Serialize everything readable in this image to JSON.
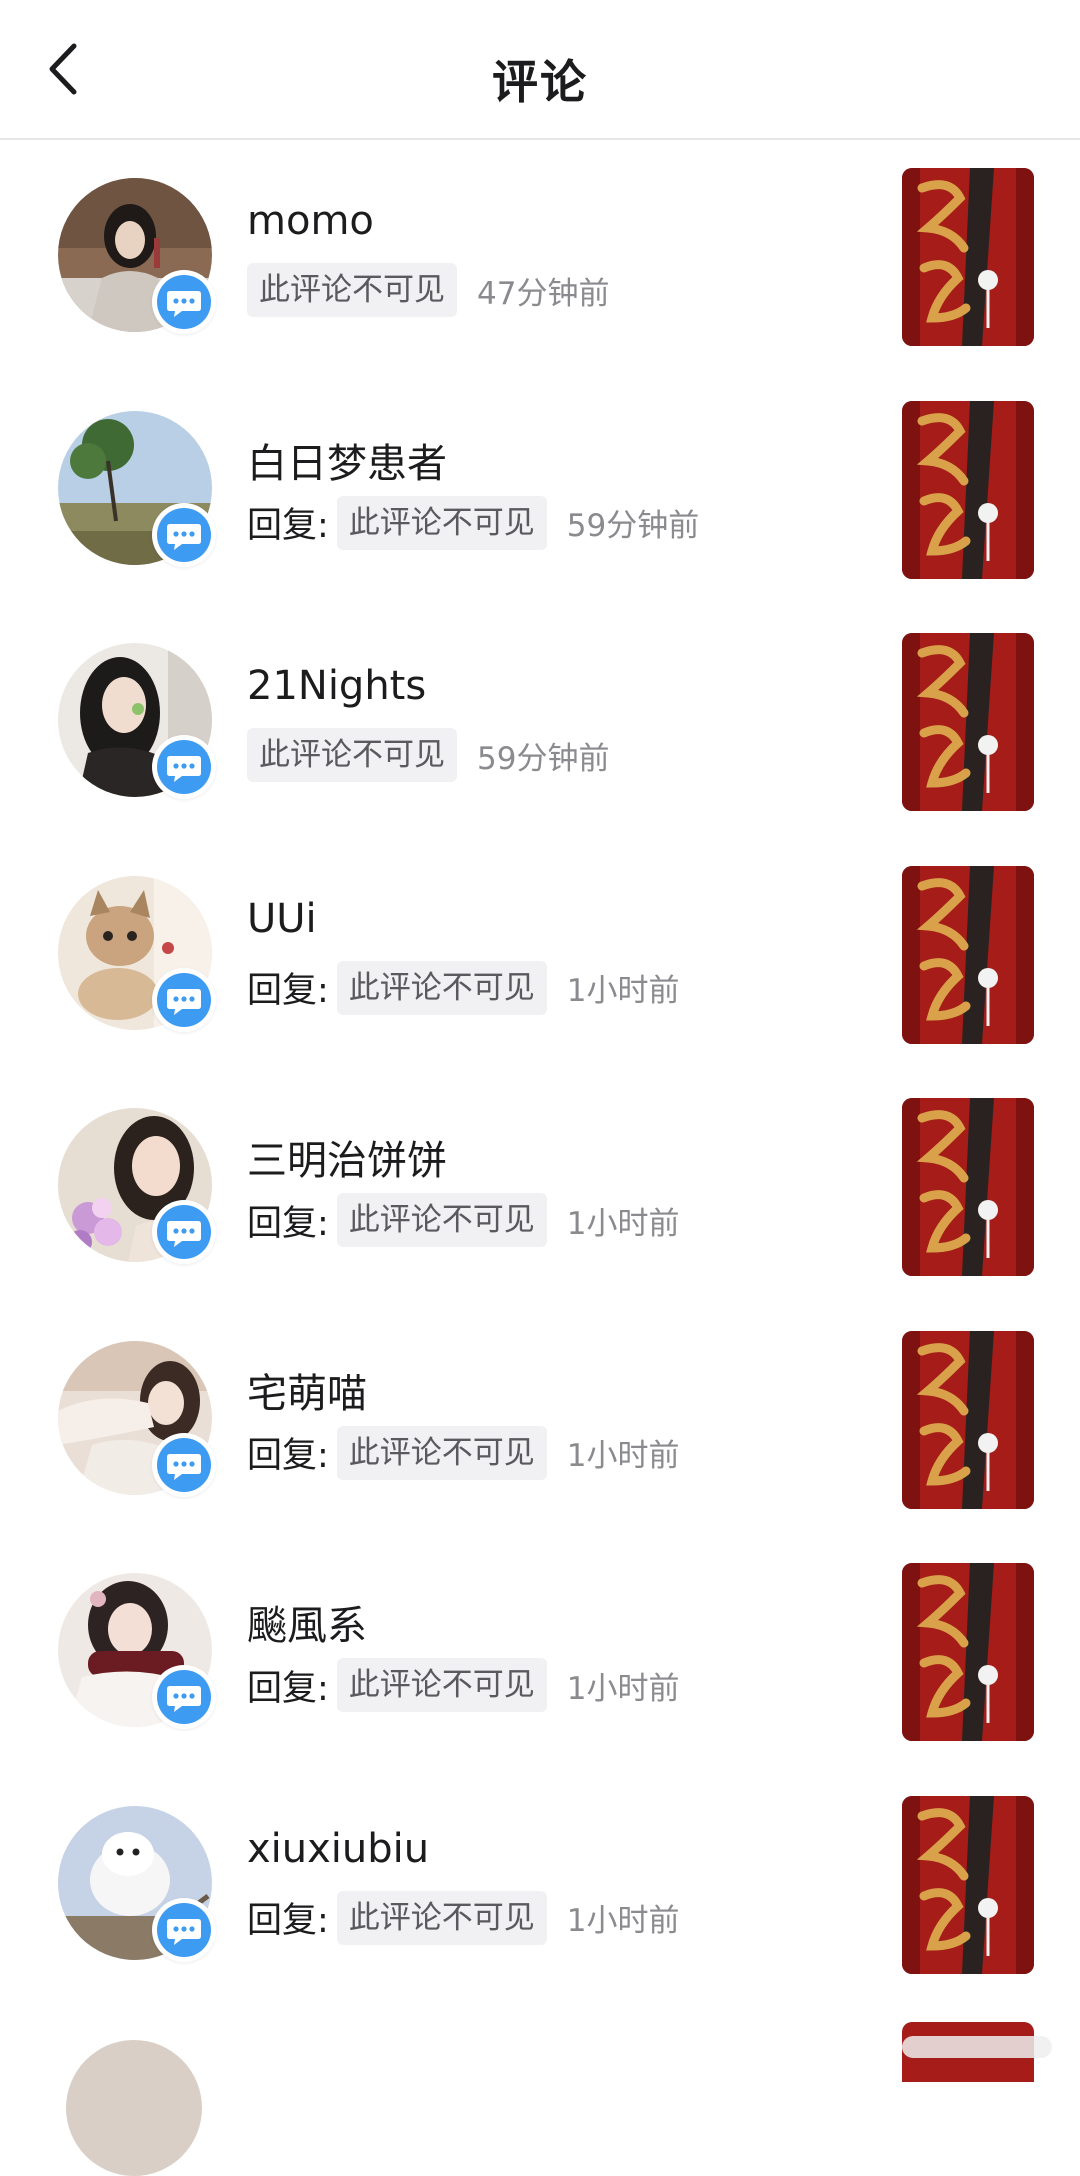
{
  "header": {
    "title": "评论",
    "back_icon": "chevron-left-icon"
  },
  "colors": {
    "badge_blue": "#3e9bf2",
    "chip_bg": "#f1f1f3",
    "time_gray": "#8a8a8f",
    "thumb_red": "#a51c18",
    "thumb_gold": "#d9a24a"
  },
  "comments": [
    {
      "name": "momo",
      "reply_label": "",
      "comment": "此评论不可见",
      "time": "47分钟前",
      "badge_icon": "comment-bubble-icon"
    },
    {
      "name": "白日梦患者",
      "reply_label": "回复:",
      "comment": "此评论不可见",
      "time": "59分钟前",
      "badge_icon": "comment-bubble-icon"
    },
    {
      "name": "21Nights",
      "reply_label": "",
      "comment": "此评论不可见",
      "time": "59分钟前",
      "badge_icon": "comment-bubble-icon"
    },
    {
      "name": "UUi",
      "reply_label": "回复:",
      "comment": "此评论不可见",
      "time": "1小时前",
      "badge_icon": "comment-bubble-icon"
    },
    {
      "name": "三明治饼饼",
      "reply_label": "回复:",
      "comment": "此评论不可见",
      "time": "1小时前",
      "badge_icon": "comment-bubble-icon"
    },
    {
      "name": "宅萌喵",
      "reply_label": "回复:",
      "comment": "此评论不可见",
      "time": "1小时前",
      "badge_icon": "comment-bubble-icon"
    },
    {
      "name": "飈風系",
      "reply_label": "回复:",
      "comment": "此评论不可见",
      "time": "1小时前",
      "badge_icon": "comment-bubble-icon"
    },
    {
      "name": "xiuxiubiu",
      "reply_label": "回复:",
      "comment": "此评论不可见",
      "time": "1小时前",
      "badge_icon": "comment-bubble-icon"
    }
  ]
}
